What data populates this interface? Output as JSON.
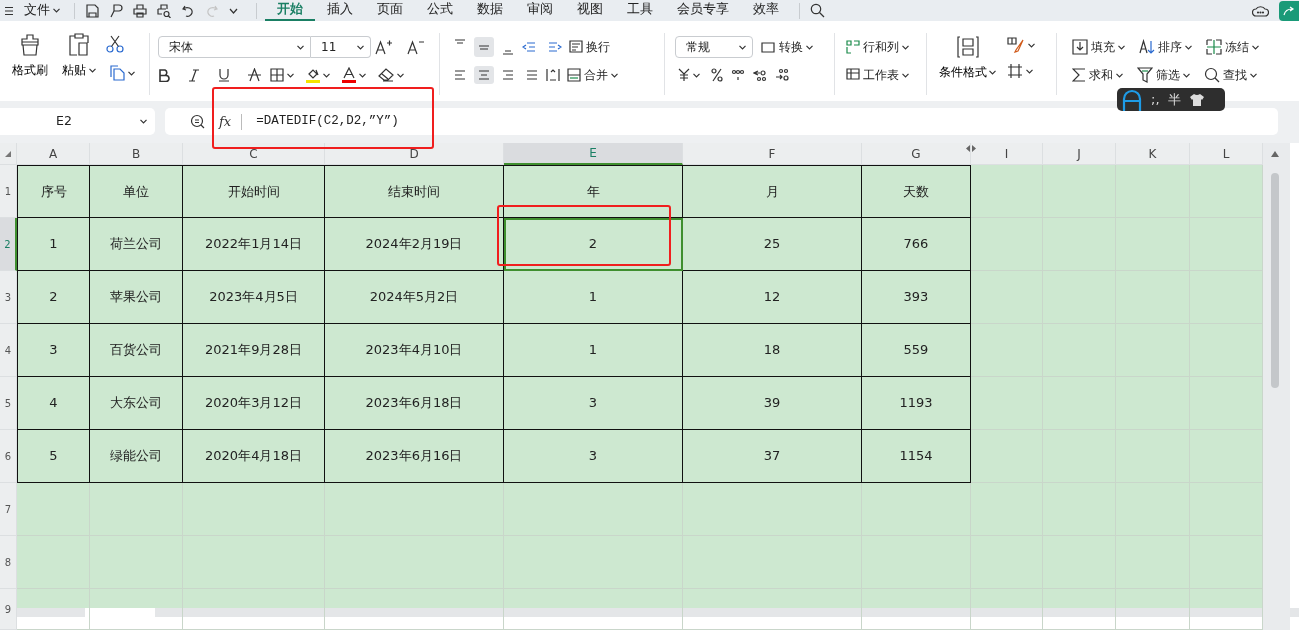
{
  "menu_bar": {
    "file_menu": "文件",
    "redo_disabled": true,
    "tabs": [
      {
        "label": "开始",
        "selected": true
      },
      {
        "label": "插入",
        "selected": false
      },
      {
        "label": "页面",
        "selected": false
      },
      {
        "label": "公式",
        "selected": false
      },
      {
        "label": "数据",
        "selected": false
      },
      {
        "label": "审阅",
        "selected": false
      },
      {
        "label": "视图",
        "selected": false
      },
      {
        "label": "工具",
        "selected": false
      },
      {
        "label": "会员专享",
        "selected": false
      },
      {
        "label": "效率",
        "selected": false
      }
    ]
  },
  "ribbon": {
    "format_painter": "格式刷",
    "paste": "粘贴",
    "font_name": "宋体",
    "font_size": "11",
    "vertical_align": [
      {
        "selected": false
      },
      {
        "selected": true
      },
      {
        "selected": false
      }
    ],
    "horizontal_align": [
      {
        "selected": false
      },
      {
        "selected": true
      },
      {
        "selected": false
      },
      {
        "selected": false
      }
    ],
    "wrap": "换行",
    "merge": "合并",
    "number_format": "常规",
    "convert": "转换",
    "rows_columns": "行和列",
    "worksheet": "工作表",
    "conditional_format": "条件格式",
    "fill": "填充",
    "sort": "排序",
    "freeze": "冻结",
    "sum": "求和",
    "filter": "筛选",
    "find": "查找"
  },
  "ime_bar": {
    "punctuation": ";,",
    "width_mode": "半"
  },
  "formula_bar": {
    "cell_ref": "E2",
    "function_label": "fx",
    "formula": "=DATEDIF(C2,D2,”Y”)"
  },
  "sheet": {
    "columns": [
      {
        "label": "A",
        "selected": false
      },
      {
        "label": "B",
        "selected": false
      },
      {
        "label": "C",
        "selected": false
      },
      {
        "label": "D",
        "selected": false
      },
      {
        "label": "E",
        "selected": true
      },
      {
        "label": "F",
        "selected": false
      },
      {
        "label": "G",
        "selected": false
      },
      {
        "label": "I",
        "selected": false
      },
      {
        "label": "J",
        "selected": false
      },
      {
        "label": "K",
        "selected": false
      },
      {
        "label": "L",
        "selected": false
      }
    ],
    "rows": [
      {
        "label": "1",
        "selected": false,
        "cells": [
          "序号",
          "单位",
          "开始时间",
          "结束时间",
          "年",
          "月",
          "天数"
        ]
      },
      {
        "label": "2",
        "selected": true,
        "cells": [
          "1",
          "荷兰公司",
          "2022年1月14日",
          "2024年2月19日",
          "2",
          "25",
          "766"
        ]
      },
      {
        "label": "3",
        "selected": false,
        "cells": [
          "2",
          "苹果公司",
          "2023年4月5日",
          "2024年5月2日",
          "1",
          "12",
          "393"
        ]
      },
      {
        "label": "4",
        "selected": false,
        "cells": [
          "3",
          "百货公司",
          "2021年9月28日",
          "2023年4月10日",
          "1",
          "18",
          "559"
        ]
      },
      {
        "label": "5",
        "selected": false,
        "cells": [
          "4",
          "大东公司",
          "2020年3月12日",
          "2023年6月18日",
          "3",
          "39",
          "1193"
        ]
      },
      {
        "label": "6",
        "selected": false,
        "cells": [
          "5",
          "绿能公司",
          "2020年4月18日",
          "2023年6月16日",
          "3",
          "37",
          "1154"
        ]
      },
      {
        "label": "7",
        "selected": false
      },
      {
        "label": "8",
        "selected": false
      },
      {
        "label": "9",
        "selected": false
      }
    ]
  }
}
